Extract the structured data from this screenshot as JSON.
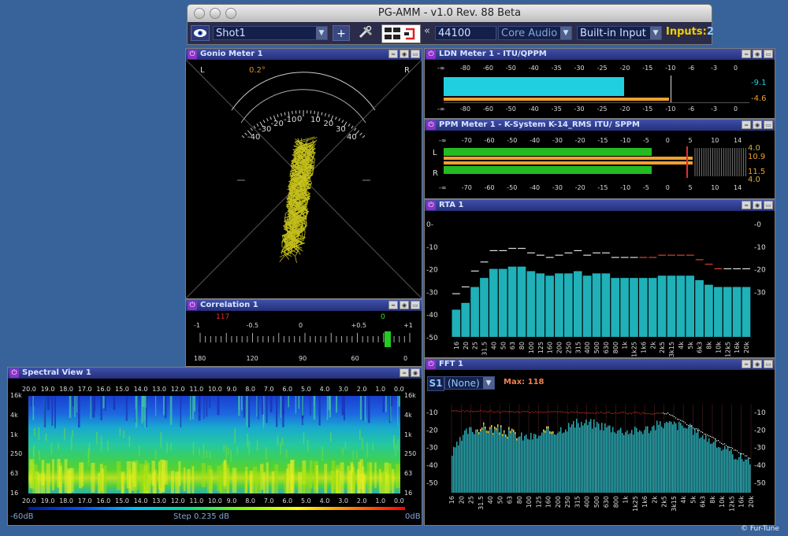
{
  "window": {
    "title": "PG-AMM - v1.0 Rev. 88 Beta"
  },
  "toolbar": {
    "preset": "Shot1",
    "add_label": "+",
    "sample_rate": "44100",
    "driver": "Core Audio",
    "device": "Built-in Input",
    "inputs_label": "Inputs:",
    "inputs_value": "2",
    "collapse_label": "«"
  },
  "gonio": {
    "title": "Gonio Meter 1",
    "left": "L",
    "right": "R",
    "angle": "0.2°",
    "scale": [
      "-40",
      "-30",
      "-20",
      "-10",
      "0",
      "10",
      "20",
      "30",
      "40"
    ]
  },
  "correlation": {
    "title": "Correlation 1",
    "peak_left": "117",
    "peak_right": "0",
    "top_scale": [
      "-1",
      "-0.5",
      "0",
      "+0.5",
      "+1"
    ],
    "bottom_scale": [
      "180",
      "120",
      "90",
      "60",
      "0"
    ]
  },
  "ldn": {
    "title": "LDN Meter 1 - ITU/QPPM",
    "scale": [
      "-∞",
      "-80",
      "-60",
      "-50",
      "-40",
      "-35",
      "-30",
      "-25",
      "-20",
      "-15",
      "-10",
      "-6",
      "-3",
      "0"
    ],
    "readouts": [
      "-9.1",
      "-4.6"
    ],
    "fill_fraction": 0.59
  },
  "ppm": {
    "title": "PPM Meter 1 - K-System K-14_RMS ITU/ SPPM",
    "scale": [
      "-∞",
      "-70",
      "-60",
      "-50",
      "-40",
      "-30",
      "-20",
      "-15",
      "-10",
      "-5",
      "0",
      "5",
      "10",
      "14"
    ],
    "channels": [
      "L",
      "R"
    ],
    "readouts": [
      "4.0",
      "10.9",
      "11.5",
      "4.0"
    ]
  },
  "rta": {
    "title": "RTA 1",
    "yscale": [
      "0-",
      "-10",
      "-20",
      "-30",
      "-40",
      "-50"
    ],
    "yscale_right": [
      "-0",
      "-10",
      "-20",
      "-30"
    ],
    "bands": [
      "16",
      "20",
      "25",
      "31.5",
      "40",
      "50",
      "63",
      "80",
      "100",
      "125",
      "160",
      "200",
      "250",
      "315",
      "400",
      "500",
      "630",
      "800",
      "1k",
      "1k25",
      "1k6",
      "2k",
      "2k5",
      "3k15",
      "4k",
      "5k",
      "6k3",
      "8k",
      "10k",
      "12k5",
      "16k",
      "20k"
    ],
    "levels": [
      -38,
      -35,
      -28,
      -24,
      -20,
      -20,
      -19,
      -19,
      -21,
      -22,
      -23,
      -22,
      -22,
      -21,
      -23,
      -22,
      -22,
      -24,
      -24,
      -24,
      -24,
      -24,
      -23,
      -23,
      -23,
      -23,
      -25,
      -27,
      -28,
      -28,
      -28,
      -28
    ]
  },
  "fft": {
    "title": "FFT 1",
    "channel": "S1",
    "overlay": "(None)",
    "max_label": "Max: 118",
    "yscale": [
      "-10",
      "-20",
      "-30",
      "-40",
      "-50"
    ],
    "bands": [
      "16",
      "20",
      "25",
      "31.5",
      "40",
      "50",
      "63",
      "80",
      "100",
      "125",
      "160",
      "200",
      "250",
      "315",
      "400",
      "500",
      "630",
      "800",
      "1k",
      "1k25",
      "1k6",
      "2k",
      "2k5",
      "3k15",
      "4k",
      "5k",
      "6k3",
      "8k",
      "10k",
      "12k5",
      "16k",
      "20k"
    ]
  },
  "spectral": {
    "title": "Spectral View 1",
    "time_scale": [
      "20.0",
      "19.0",
      "18.0",
      "17.0",
      "16.0",
      "15.0",
      "14.0",
      "13.0",
      "12.0",
      "11.0",
      "10.0",
      "9.0",
      "8.0",
      "7.0",
      "6.0",
      "5.0",
      "4.0",
      "3.0",
      "2.0",
      "1.0",
      "0.0"
    ],
    "freq_scale": [
      "16k",
      "4k",
      "1k",
      "250",
      "63",
      "16"
    ],
    "min_db": "-60dB",
    "step": "Step 0.235 dB",
    "max_db": "0dB"
  },
  "watermark": "© Fur-Tune",
  "colors": {
    "panel_head": "#3e4fa8",
    "meter_cyan": "#20d0e0",
    "meter_green": "#22bb22",
    "meter_orange": "#f0a030",
    "rta_bar": "#1fb0b8"
  }
}
